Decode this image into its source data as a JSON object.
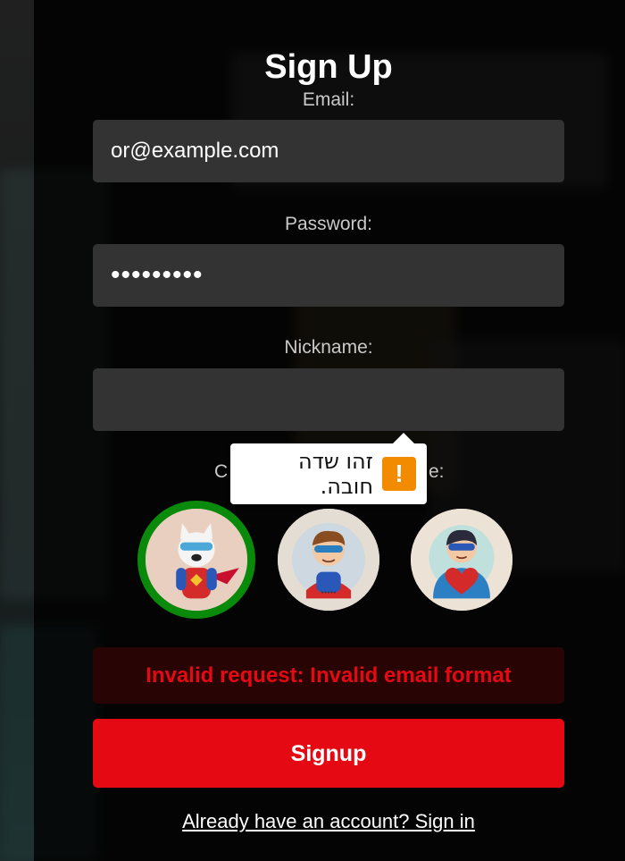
{
  "form": {
    "title": "Sign Up",
    "email_label": "Email:",
    "email_value": "or@example.com",
    "password_label": "Password:",
    "password_value": "•••••••••",
    "nickname_label": "Nickname:",
    "nickname_value": "",
    "avatar_label_prefix": "C",
    "avatar_label_suffix": "e:",
    "validation_tooltip": "זהו שדה חובה.",
    "validation_icon": "!",
    "error_message": "Invalid request: Invalid email format",
    "submit_label": "Signup",
    "signin_link": "Already have an account? Sign in"
  },
  "avatars": [
    {
      "name": "dog-hero",
      "selected": true
    },
    {
      "name": "boy-hero",
      "selected": false
    },
    {
      "name": "heart-hero",
      "selected": false
    }
  ],
  "colors": {
    "accent": "#e50914",
    "selected_border": "#0a8a0a",
    "warning": "#f28b00",
    "error_bg": "#280404",
    "field_bg": "#333333"
  }
}
